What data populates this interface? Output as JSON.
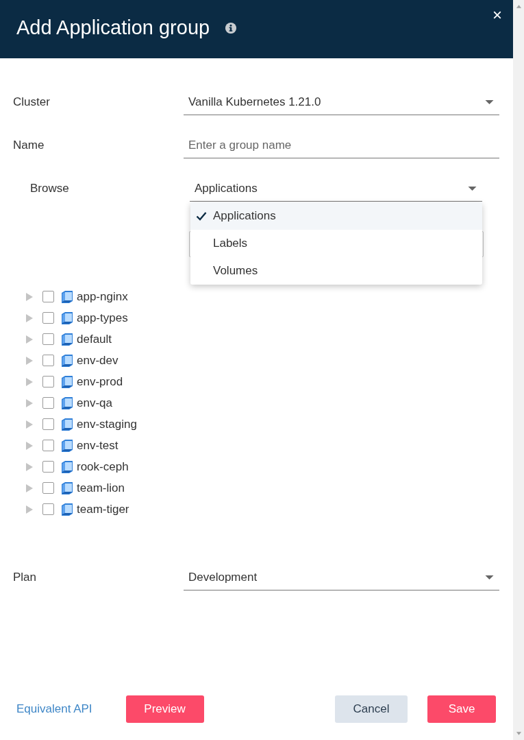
{
  "dialog": {
    "title": "Add Application group",
    "close": "×"
  },
  "form": {
    "cluster": {
      "label": "Cluster",
      "value": "Vanilla Kubernetes 1.21.0"
    },
    "name": {
      "label": "Name",
      "placeholder": "Enter a group name"
    },
    "browse": {
      "label": "Browse",
      "value": "Applications",
      "expanded": true,
      "options": [
        {
          "label": "Applications",
          "selected": true
        },
        {
          "label": "Labels",
          "selected": false
        },
        {
          "label": "Volumes",
          "selected": false
        }
      ]
    },
    "tree": [
      {
        "label": "app-nginx",
        "checked": false,
        "expanded": false
      },
      {
        "label": "app-types",
        "checked": false,
        "expanded": false
      },
      {
        "label": "default",
        "checked": false,
        "expanded": false
      },
      {
        "label": "env-dev",
        "checked": false,
        "expanded": false
      },
      {
        "label": "env-prod",
        "checked": false,
        "expanded": false
      },
      {
        "label": "env-qa",
        "checked": false,
        "expanded": false
      },
      {
        "label": "env-staging",
        "checked": false,
        "expanded": false
      },
      {
        "label": "env-test",
        "checked": false,
        "expanded": false
      },
      {
        "label": "rook-ceph",
        "checked": false,
        "expanded": false
      },
      {
        "label": "team-lion",
        "checked": false,
        "expanded": false
      },
      {
        "label": "team-tiger",
        "checked": false,
        "expanded": false
      }
    ],
    "plan": {
      "label": "Plan",
      "value": "Development"
    }
  },
  "footer": {
    "link": "Equivalent API",
    "buttons": [
      {
        "label": "Preview",
        "kind": "primary"
      },
      {
        "label": "Cancel",
        "kind": "secondary"
      },
      {
        "label": "Save",
        "kind": "primary"
      }
    ]
  }
}
